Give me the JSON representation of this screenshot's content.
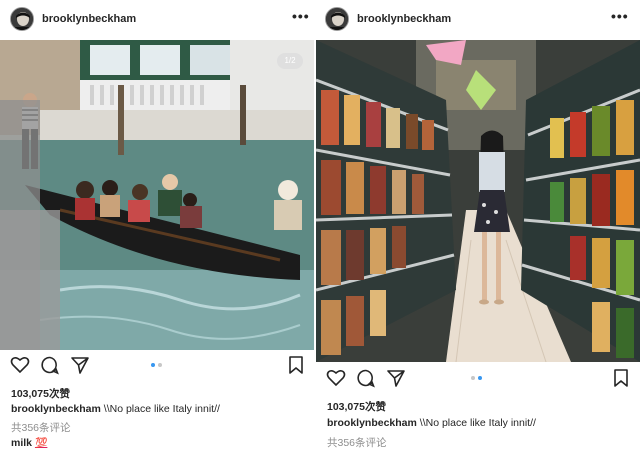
{
  "posts": [
    {
      "username": "brooklynbeckham",
      "more": "•••",
      "counter": "1/2",
      "likes": "103,075次赞",
      "caption_user": "brooklynbeckham",
      "caption_text": " \\\\No place like Italy innit//",
      "comments": "共356条评论",
      "extra_user": "milk",
      "extra_emoji": "💯",
      "carousel_active": 0
    },
    {
      "username": "brooklynbeckham",
      "more": "•••",
      "likes": "103,075次赞",
      "caption_user": "brooklynbeckham",
      "caption_text": " \\\\No place like Italy innit//",
      "comments": "共356条评论",
      "carousel_active": 1
    }
  ],
  "icons": [
    "avatar",
    "more-icon",
    "heart-icon",
    "comment-icon",
    "share-icon",
    "bookmark-icon"
  ],
  "colors": {
    "accent": "#3897f0",
    "text": "#262626",
    "muted": "#8e8e8e"
  }
}
